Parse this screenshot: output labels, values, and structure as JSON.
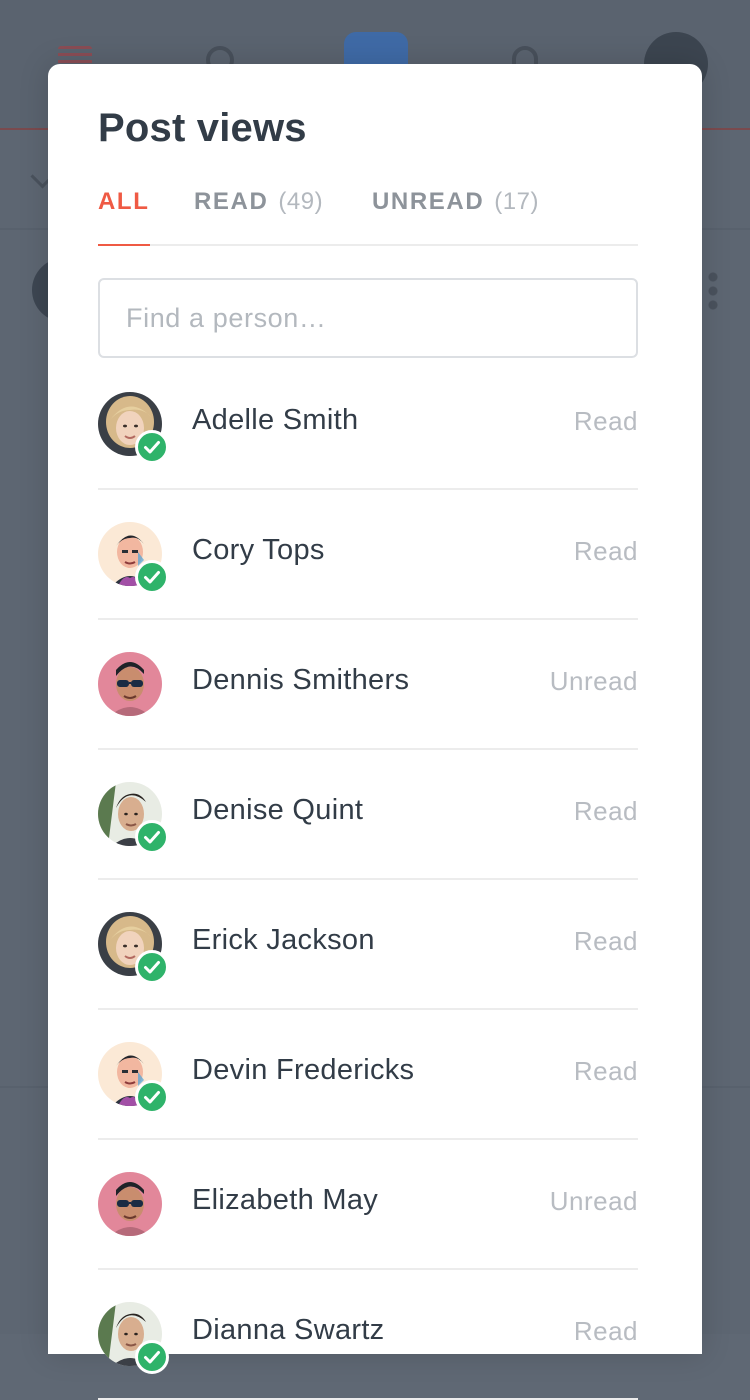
{
  "modal": {
    "title": "Post views",
    "tabs": [
      {
        "label": "ALL",
        "count": ""
      },
      {
        "label": "READ",
        "count": "(49)"
      },
      {
        "label": "UNREAD",
        "count": "(17)"
      }
    ],
    "search_placeholder": "Find a person…"
  },
  "people": [
    {
      "name": "Adelle Smith",
      "status": "Read",
      "avatar": "avatar-woman-blonde",
      "verified": true
    },
    {
      "name": "Cory Tops",
      "status": "Read",
      "avatar": "avatar-man-illustrated",
      "verified": true
    },
    {
      "name": "Dennis Smithers",
      "status": "Unread",
      "avatar": "avatar-man-sunglasses",
      "verified": false
    },
    {
      "name": "Denise Quint",
      "status": "Read",
      "avatar": "avatar-man-dark-hair",
      "verified": true
    },
    {
      "name": "Erick Jackson",
      "status": "Read",
      "avatar": "avatar-woman-blonde",
      "verified": true
    },
    {
      "name": "Devin Fredericks",
      "status": "Read",
      "avatar": "avatar-man-illustrated",
      "verified": true
    },
    {
      "name": "Elizabeth May",
      "status": "Unread",
      "avatar": "avatar-man-sunglasses",
      "verified": false
    },
    {
      "name": "Dianna Swartz",
      "status": "Read",
      "avatar": "avatar-man-dark-hair",
      "verified": true
    }
  ],
  "colors": {
    "accent": "#ef5a44",
    "verified": "#2fb36a",
    "text": "#323c47",
    "muted": "#b8bcc2",
    "overlay": "#5d6672"
  }
}
